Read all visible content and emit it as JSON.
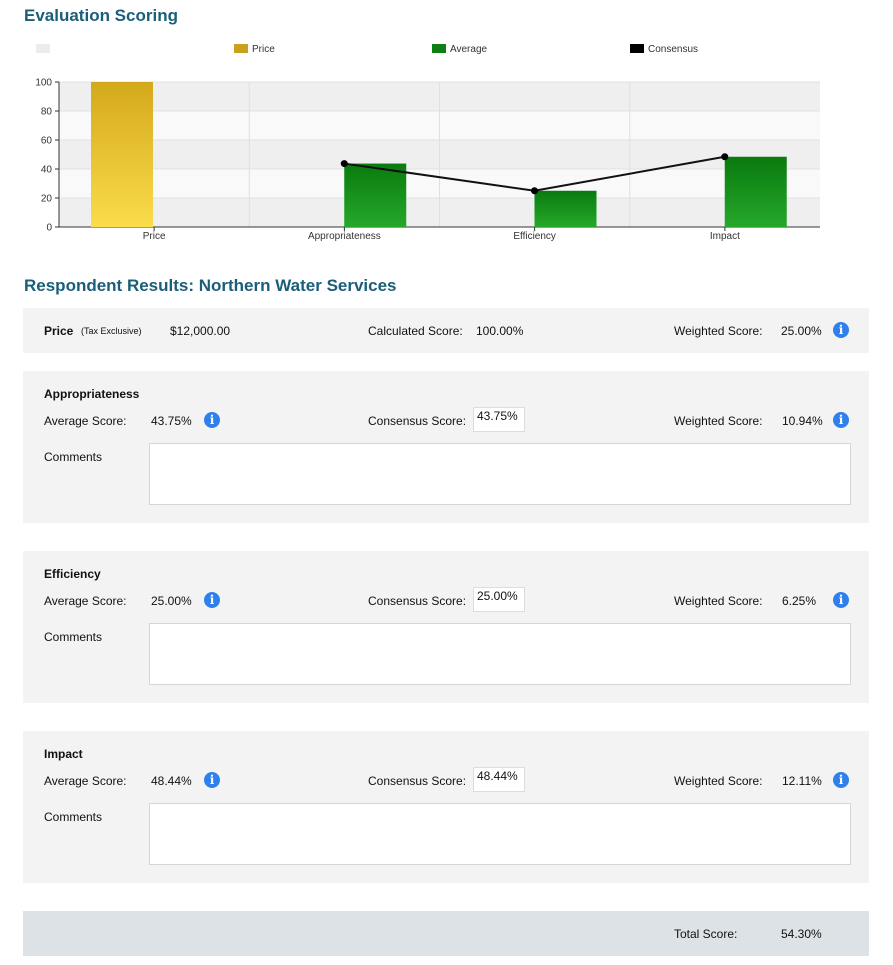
{
  "headings": {
    "evaluation_scoring": "Evaluation Scoring",
    "respondent_results": "Respondent Results: Northern Water Services"
  },
  "colors": {
    "price": "#c9a21b",
    "average": "#0e7f12",
    "consensus": "#000000",
    "heading": "#1b5e7a",
    "info": "#2f80ed"
  },
  "chart_data": {
    "type": "bar",
    "categories": [
      "Price",
      "Appropriateness",
      "Efficiency",
      "Impact"
    ],
    "series": [
      {
        "name": "Price",
        "type": "bar",
        "values": [
          100,
          null,
          null,
          null
        ]
      },
      {
        "name": "Average",
        "type": "bar",
        "values": [
          null,
          43.75,
          25.0,
          48.44
        ]
      },
      {
        "name": "Consensus",
        "type": "line",
        "values": [
          null,
          43.75,
          25.0,
          48.44
        ]
      }
    ],
    "yticks": [
      0,
      20,
      40,
      60,
      80,
      100
    ],
    "ylim": [
      0,
      100
    ],
    "grid": true,
    "legend_position": "top"
  },
  "price_row": {
    "label": "Price",
    "note": "(Tax Exclusive)",
    "amount": "$12,000.00",
    "calculated_label": "Calculated Score:",
    "calculated_value": "100.00%",
    "weighted_label": "Weighted Score:",
    "weighted_value": "25.00%"
  },
  "labels": {
    "average": "Average Score:",
    "consensus": "Consensus Score:",
    "weighted": "Weighted Score:",
    "comments": "Comments"
  },
  "criteria": [
    {
      "title": "Appropriateness",
      "average": "43.75%",
      "consensus": "43.75%",
      "weighted": "10.94%",
      "comment": ""
    },
    {
      "title": "Efficiency",
      "average": "25.00%",
      "consensus": "25.00%",
      "weighted": "6.25%",
      "comment": ""
    },
    {
      "title": "Impact",
      "average": "48.44%",
      "consensus": "48.44%",
      "weighted": "12.11%",
      "comment": ""
    }
  ],
  "total": {
    "label": "Total Score:",
    "value": "54.30%"
  }
}
